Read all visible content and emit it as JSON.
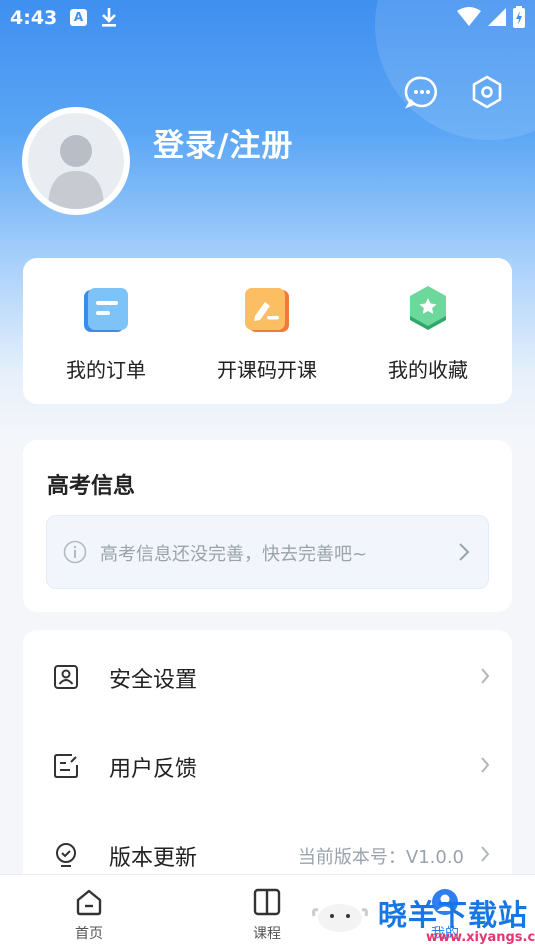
{
  "status_bar": {
    "time": "4:43",
    "notif_letter": "A"
  },
  "header": {
    "login_title": "登录/注册"
  },
  "quick_actions": [
    {
      "label": "我的订单",
      "icon": "orders-icon"
    },
    {
      "label": "开课码开课",
      "icon": "course-code-icon"
    },
    {
      "label": "我的收藏",
      "icon": "favorites-icon"
    }
  ],
  "gaokao": {
    "title": "高考信息",
    "hint": "高考信息还没完善，快去完善吧~"
  },
  "menu": [
    {
      "label": "安全设置",
      "value": "",
      "icon": "security-icon"
    },
    {
      "label": "用户反馈",
      "value": "",
      "icon": "feedback-icon"
    },
    {
      "label": "版本更新",
      "value": "当前版本号：V1.0.0",
      "icon": "update-icon"
    }
  ],
  "bottom_nav": [
    {
      "label": "首页",
      "icon": "home-icon"
    },
    {
      "label": "课程",
      "icon": "book-icon"
    },
    {
      "label": "我的",
      "icon": "profile-icon",
      "active": true
    }
  ],
  "watermark": {
    "text": "晓羊下载站",
    "url": "www.xiyangs.com"
  },
  "colors": {
    "accent": "#2e7ef0",
    "hero_top": "#3f8ff0",
    "watermark_blue": "#1676e4",
    "watermark_red": "#e2376f"
  }
}
